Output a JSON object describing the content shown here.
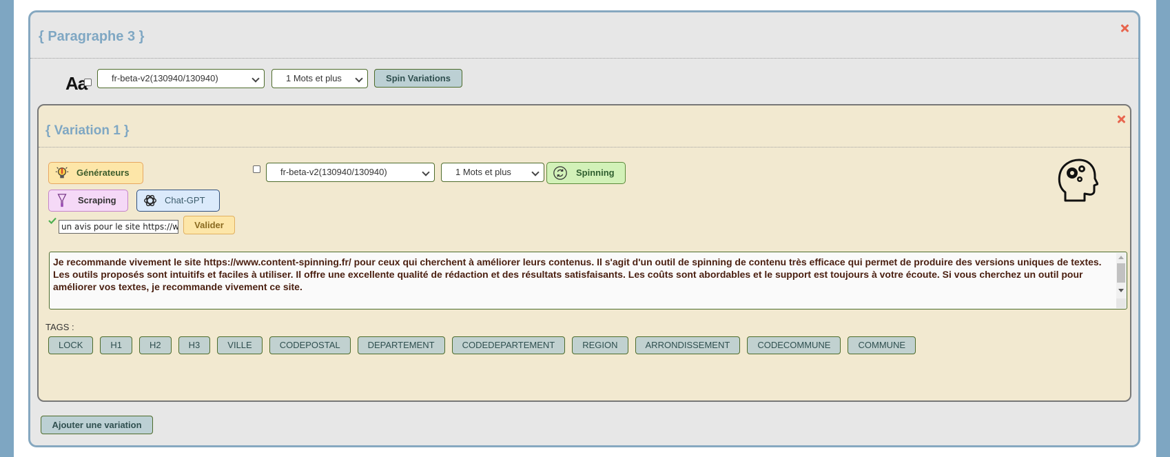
{
  "paragraph": {
    "title": "{ Paragraphe 3 }",
    "case_label": "Aa",
    "dictionary_select": "fr-beta-v2(130940/130940)",
    "words_select": "1 Mots et plus",
    "spin_button": "Spin Variations",
    "add_variation_button": "Ajouter une variation"
  },
  "variation": {
    "title": "{ Variation 1 }",
    "generators_button": "Générateurs",
    "scraping_button": "Scraping",
    "chatgpt_button": "Chat-GPT",
    "dictionary_select": "fr-beta-v2(130940/130940)",
    "words_select": "1 Mots et plus",
    "spinning_button": "Spinning",
    "prompt_value": "un avis pour le site https://www.content-spinning.fr/",
    "validate_button": "Valider",
    "content": "Je recommande vivement le site https://www.content-spinning.fr/ pour ceux qui cherchent à améliorer leurs contenus. Il s'agit d'un outil de spinning de contenu très efficace qui permet de produire des versions uniques de textes. Les outils proposés sont intuitifs et faciles à utiliser. Il offre une excellente qualité de rédaction et des résultats satisfaisants. Les coûts sont abordables et le support est toujours à votre écoute. Si vous cherchez un outil pour améliorer vos textes, je recommande vivement ce site.",
    "tags_label": "TAGS :",
    "tags": [
      "LOCK",
      "H1",
      "H2",
      "H3",
      "VILLE",
      "CODEPOSTAL",
      "DEPARTEMENT",
      "CODEDEPARTEMENT",
      "REGION",
      "ARRONDISSEMENT",
      "CODECOMMUNE",
      "COMMUNE"
    ]
  },
  "icons": {
    "close": "close-icon",
    "generators": "lightbulb-icon",
    "scraping": "funnel-icon",
    "chatgpt": "openai-icon",
    "spinning": "refresh-icon",
    "brain": "brain-gears-icon",
    "check": "check-icon"
  },
  "colors": {
    "title_blue": "#7fa7c3",
    "close_red": "#e8654e",
    "panel_border": "#86a8c0",
    "variation_bg": "#f2e9d0"
  }
}
